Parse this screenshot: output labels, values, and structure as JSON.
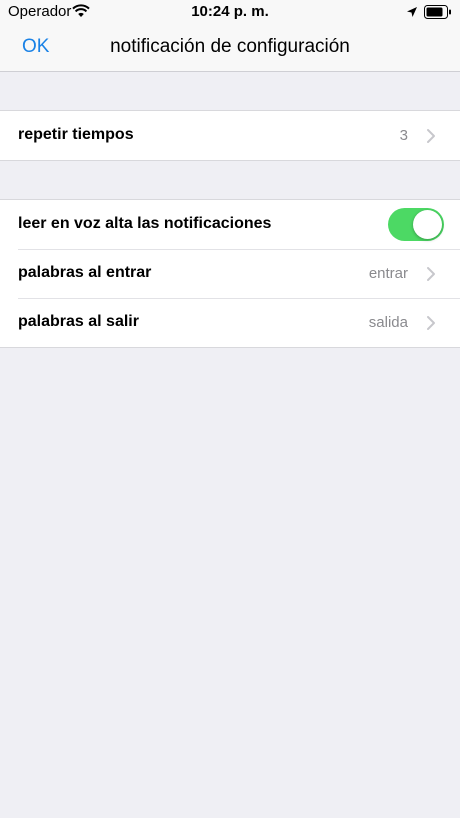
{
  "status": {
    "carrier": "Operador",
    "time": "10:24 p. m.",
    "icons": [
      "wifi-icon",
      "location-arrow-icon",
      "battery-icon"
    ]
  },
  "nav": {
    "left_button": "OK",
    "title": "notificación de configuración",
    "accent_color": "#1a82e6"
  },
  "group1": {
    "rows": [
      {
        "label": "repetir tiempos",
        "value": "3",
        "icon": "chevron-right-icon"
      }
    ]
  },
  "group2": {
    "rows": [
      {
        "label": "leer en voz alta las notificaciones",
        "toggle": true,
        "toggle_color": "#4cd964"
      },
      {
        "label": "palabras al entrar",
        "value": "entrar",
        "icon": "chevron-right-icon"
      },
      {
        "label": "palabras al salir",
        "value": "salida",
        "icon": "chevron-right-icon"
      }
    ]
  }
}
